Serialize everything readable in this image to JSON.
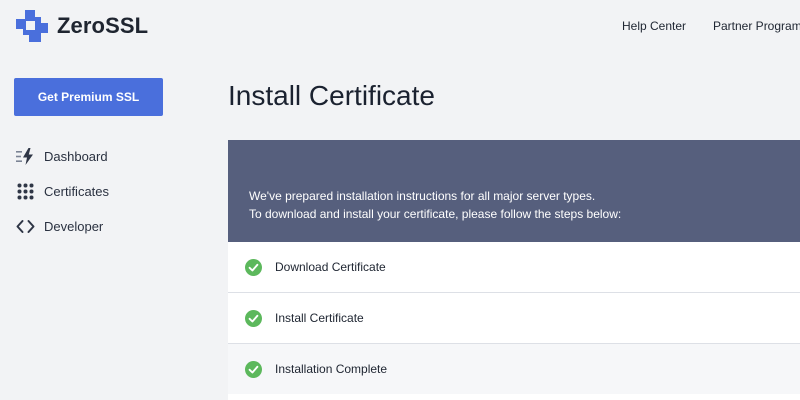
{
  "brand": {
    "name": "ZeroSSL",
    "logo_icon": "zerossl-logo-icon",
    "color": "#4a6fdc"
  },
  "header": {
    "links": [
      "Help Center",
      "Partner Program"
    ]
  },
  "sidebar": {
    "cta_label": "Get Premium SSL",
    "items": [
      {
        "label": "Dashboard",
        "icon": "lightning-icon"
      },
      {
        "label": "Certificates",
        "icon": "grid-dots-icon"
      },
      {
        "label": "Developer",
        "icon": "code-brackets-icon"
      }
    ]
  },
  "main": {
    "title": "Install Certificate",
    "intro": [
      "We've prepared installation instructions for all major server types.",
      "To download and install your certificate, please follow the steps below:"
    ],
    "steps": [
      {
        "label": "Download Certificate",
        "status": "complete"
      },
      {
        "label": "Install Certificate",
        "status": "complete"
      },
      {
        "label": "Installation Complete",
        "status": "complete"
      }
    ]
  },
  "colors": {
    "accent": "#4a6fdc",
    "card_header": "#565f7d",
    "check_green": "#5cb85c",
    "background": "#f2f3f5"
  }
}
